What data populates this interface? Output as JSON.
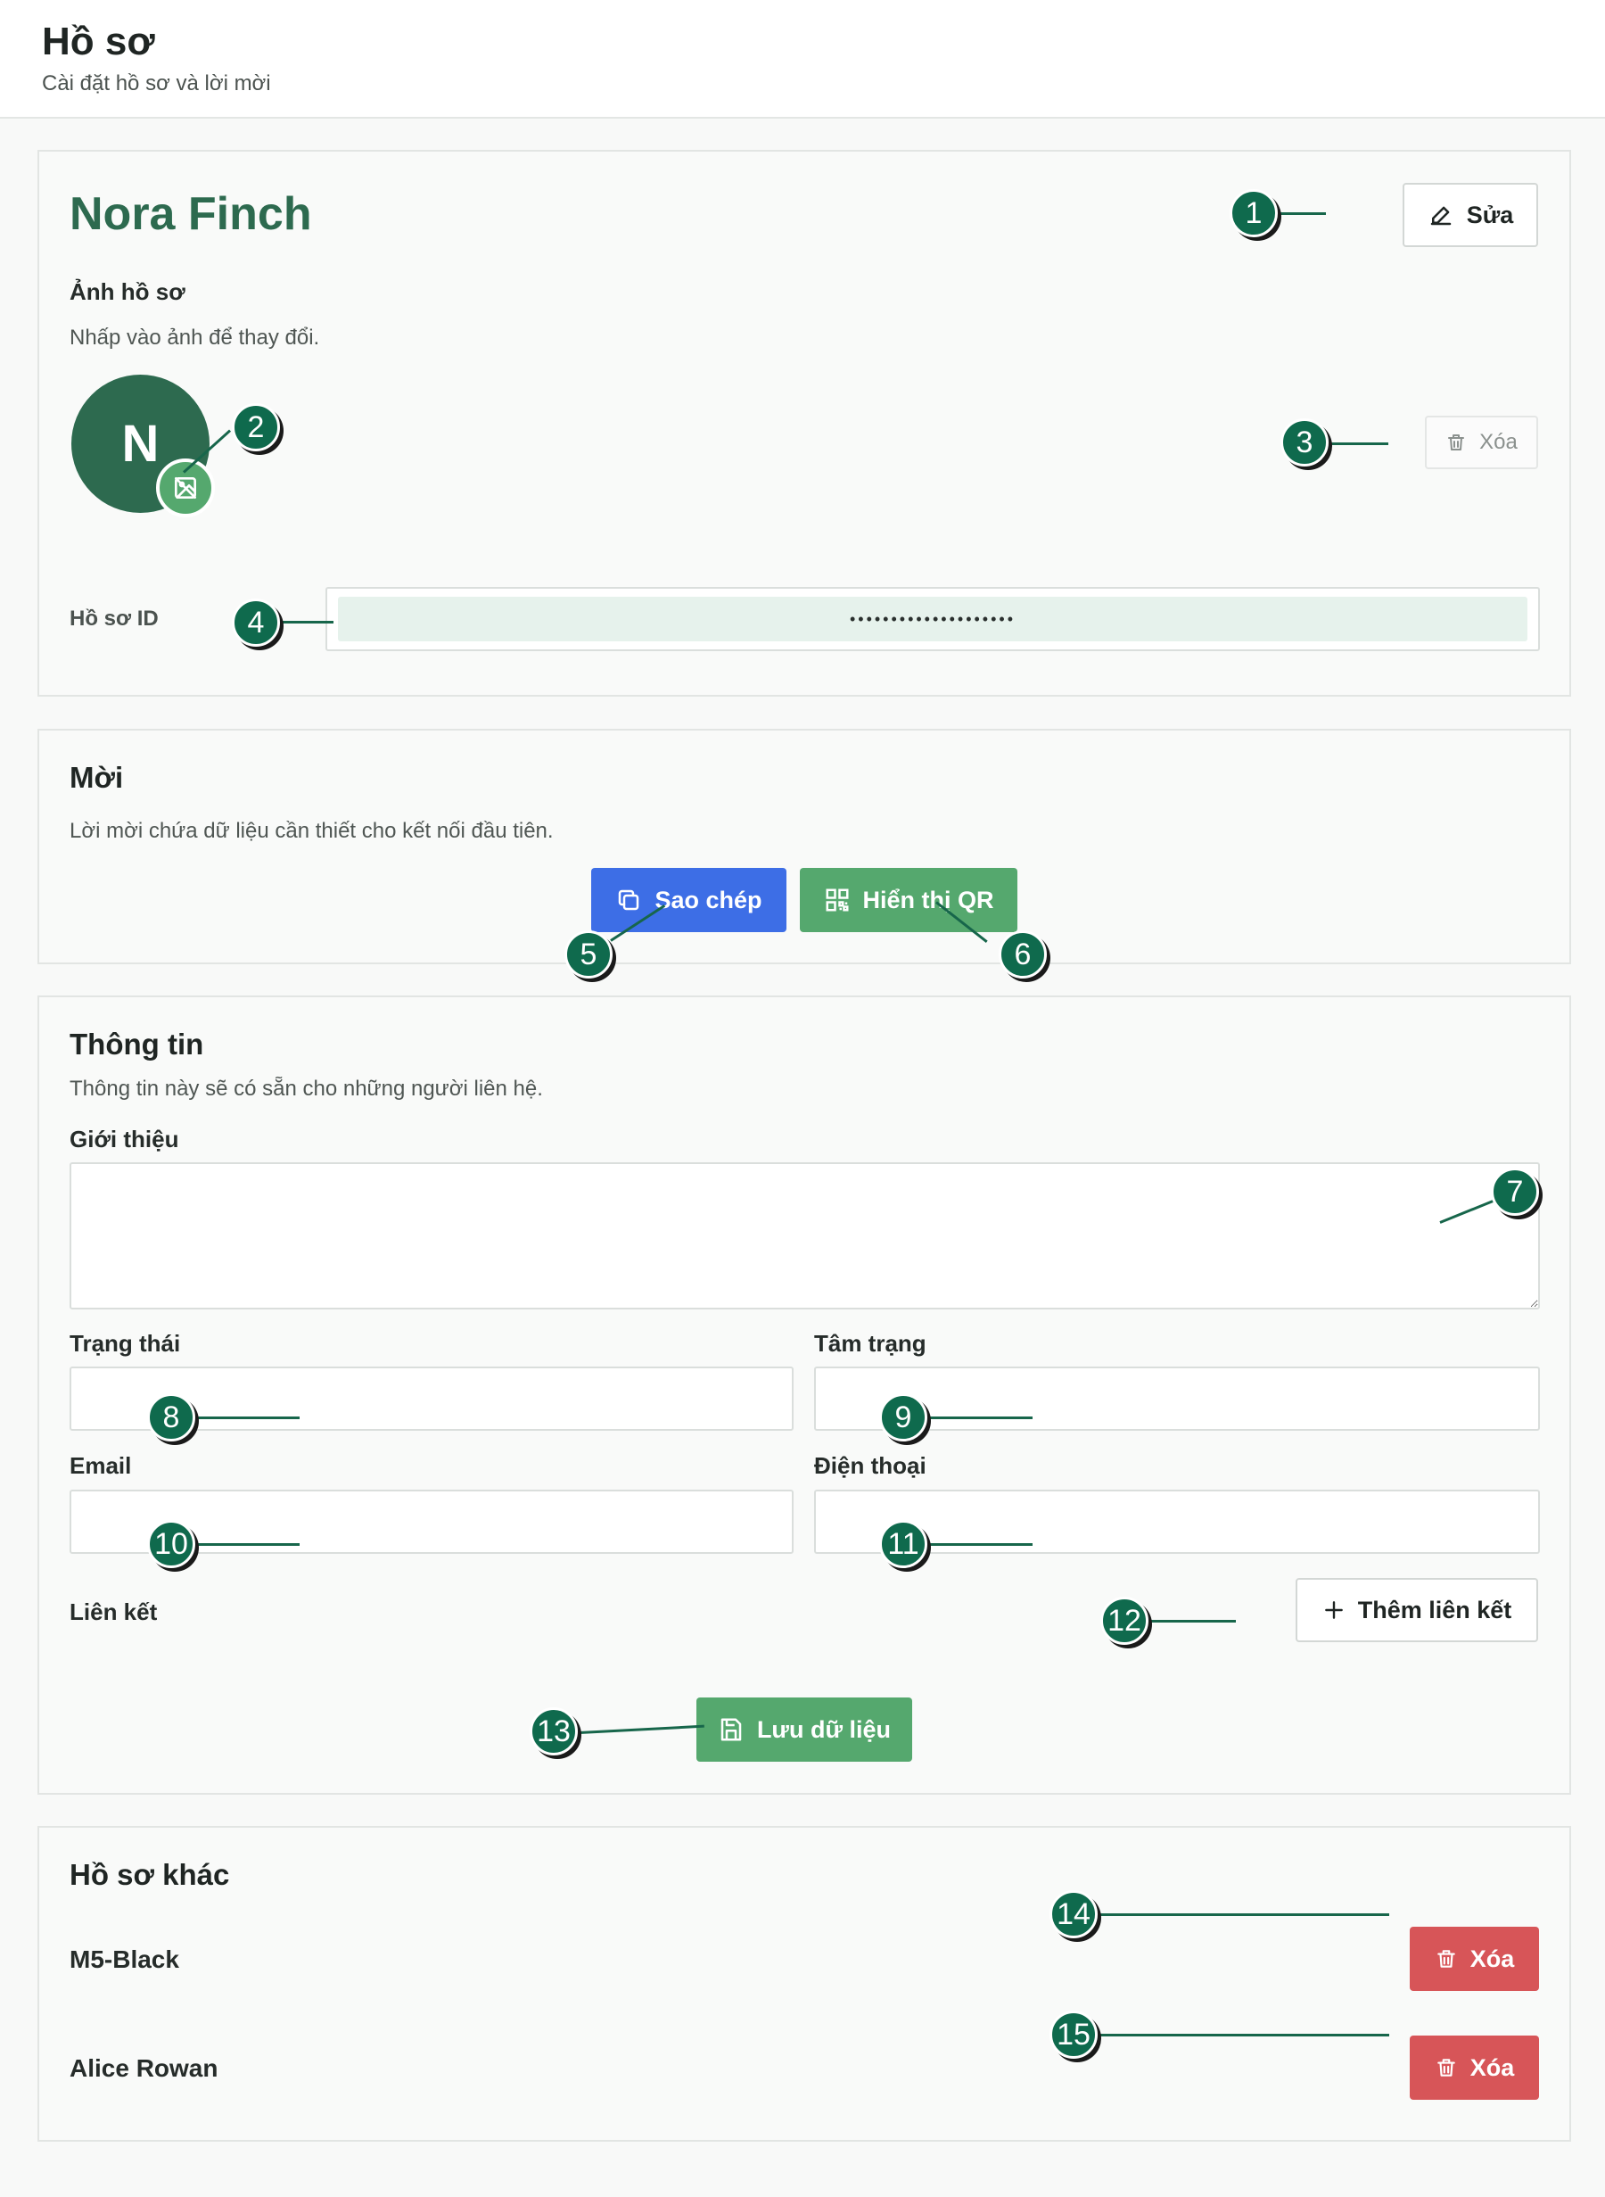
{
  "header": {
    "title": "Hồ sơ",
    "subtitle": "Cài đặt hồ sơ và lời mời"
  },
  "profile": {
    "name": "Nora Finch",
    "edit_label": "Sửa",
    "photo_title": "Ảnh hồ sơ",
    "photo_hint": "Nhấp vào ảnh để thay đổi.",
    "avatar_initial": "N",
    "delete_photo_label": "Xóa",
    "id_label": "Hồ sơ ID",
    "id_value": "••••••••••••••••••••"
  },
  "invite": {
    "title": "Mời",
    "description": "Lời mời chứa dữ liệu cần thiết cho kết nối đầu tiên.",
    "copy_label": "Sao chép",
    "qr_label": "Hiển thị QR"
  },
  "info": {
    "title": "Thông tin",
    "description": "Thông tin này sẽ có sẵn cho những người liên hệ.",
    "intro_label": "Giới thiệu",
    "intro_value": "",
    "status_label": "Trạng thái",
    "status_value": "",
    "mood_label": "Tâm trạng",
    "mood_value": "",
    "email_label": "Email",
    "email_value": "",
    "phone_label": "Điện thoại",
    "phone_value": "",
    "links_label": "Liên kết",
    "add_link_label": "Thêm liên kết",
    "save_label": "Lưu dữ liệu"
  },
  "other_profiles": {
    "title": "Hồ sơ khác",
    "items": [
      {
        "name": "M5-Black",
        "delete_label": "Xóa"
      },
      {
        "name": "Alice Rowan",
        "delete_label": "Xóa"
      }
    ]
  },
  "markers": [
    "1",
    "2",
    "3",
    "4",
    "5",
    "6",
    "7",
    "8",
    "9",
    "10",
    "11",
    "12",
    "13",
    "14",
    "15"
  ],
  "colors": {
    "accent_green": "#55a86e",
    "brand_dark_green": "#2d6a4f",
    "primary_blue": "#3d6ee6",
    "danger_red": "#d75558",
    "marker_green": "#0f6a4d"
  }
}
